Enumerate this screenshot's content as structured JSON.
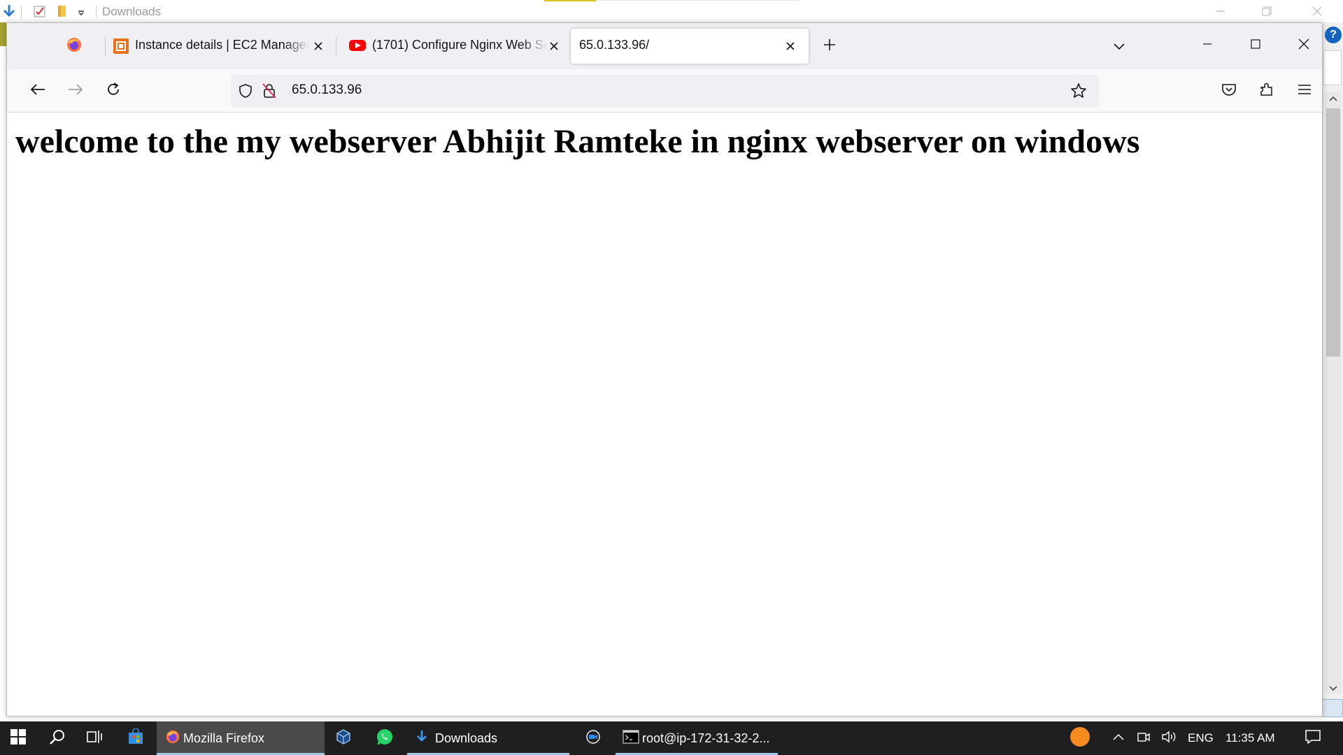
{
  "explorer": {
    "title": "Downloads"
  },
  "browser": {
    "tabs": [
      {
        "label": "",
        "icon": "firefox-icon"
      },
      {
        "label": "Instance details | EC2 Managem",
        "icon": "aws-ec2-icon"
      },
      {
        "label": "(1701) Configure Nginx Web Se",
        "icon": "youtube-icon"
      },
      {
        "label": "65.0.133.96/",
        "icon": "",
        "active": true
      }
    ],
    "url": "65.0.133.96",
    "page_heading": "welcome to the my webserver Abhijit Ramteke in nginx webserver on windows"
  },
  "taskbar": {
    "apps": [
      {
        "label": "Mozilla Firefox",
        "icon": "firefox-icon"
      },
      {
        "label": "",
        "icon": "virtualbox-icon"
      },
      {
        "label": "",
        "icon": "whatsapp-icon"
      },
      {
        "label": "Downloads",
        "icon": "download-folder-icon"
      },
      {
        "label": "",
        "icon": "zoom-icon"
      },
      {
        "label": "root@ip-172-31-32-2...",
        "icon": "terminal-icon"
      }
    ],
    "language": "ENG",
    "time": "11:35 AM"
  },
  "colors": {
    "accent_youtube": "#ff0000",
    "accent_aws": "#e8731a",
    "taskbar_bg": "#1f1f1f",
    "help_badge": "#1565c0"
  }
}
